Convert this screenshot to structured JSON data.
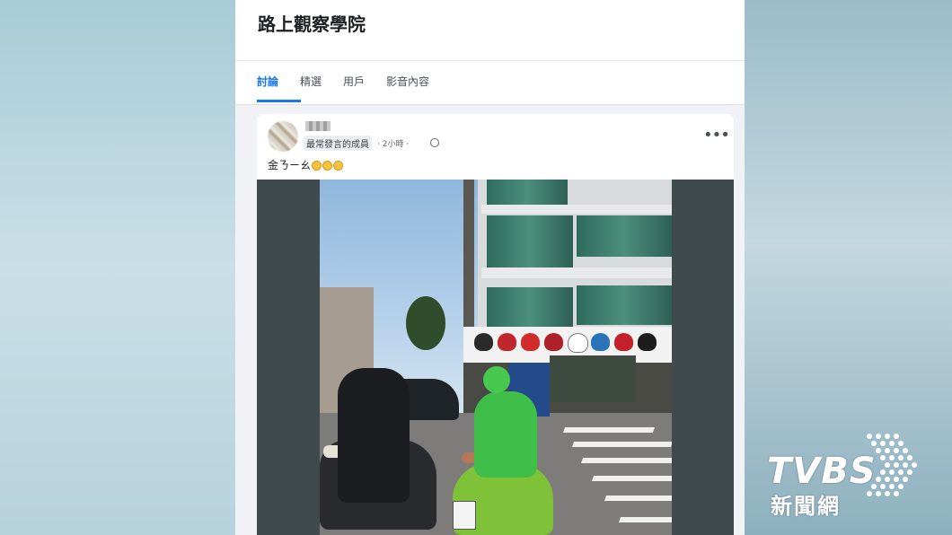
{
  "group": {
    "title": "路上觀察學院"
  },
  "tabs": [
    {
      "label": "討論",
      "active": true
    },
    {
      "label": "精選",
      "active": false
    },
    {
      "label": "用戶",
      "active": false
    },
    {
      "label": "影音內容",
      "active": false
    }
  ],
  "post": {
    "member_badge": "最常發言的成員",
    "time": "· 2小時 ·",
    "text": "金ㄋㄧㄠ"
  },
  "watermark": {
    "main": "TVBS",
    "sub": "新聞網"
  },
  "colors": {
    "accent": "#1877f2",
    "frame": "#3e4a4b"
  }
}
